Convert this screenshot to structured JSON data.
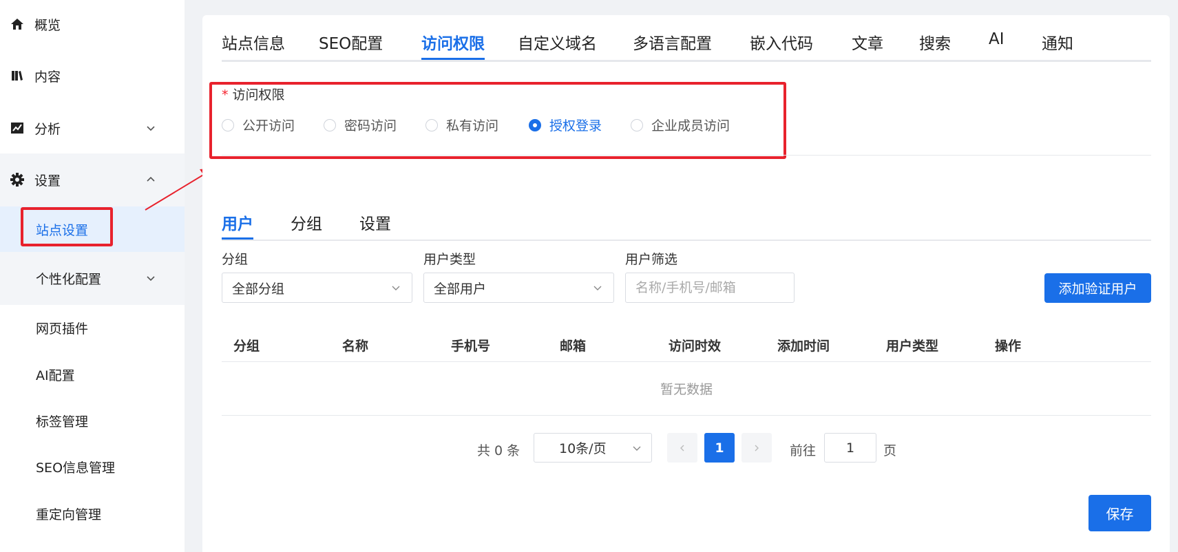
{
  "sidebar": {
    "items": [
      {
        "label": "概览",
        "icon": "home-icon"
      },
      {
        "label": "内容",
        "icon": "book-icon"
      },
      {
        "label": "分析",
        "icon": "chart-icon"
      },
      {
        "label": "设置",
        "icon": "gear-icon"
      }
    ],
    "settings_sub": [
      {
        "label": "站点设置"
      },
      {
        "label": "个性化配置"
      }
    ],
    "other_items": [
      {
        "label": "网页插件"
      },
      {
        "label": "AI配置"
      },
      {
        "label": "标签管理"
      },
      {
        "label": "SEO信息管理"
      },
      {
        "label": "重定向管理"
      }
    ]
  },
  "tabs": [
    {
      "label": "站点信息"
    },
    {
      "label": "SEO配置"
    },
    {
      "label": "访问权限"
    },
    {
      "label": "自定义域名"
    },
    {
      "label": "多语言配置"
    },
    {
      "label": "嵌入代码"
    },
    {
      "label": "文章"
    },
    {
      "label": "搜索"
    },
    {
      "label": "AI"
    },
    {
      "label": "通知"
    }
  ],
  "access": {
    "required_mark": "*",
    "label": "访问权限",
    "options": [
      {
        "label": "公开访问"
      },
      {
        "label": "密码访问"
      },
      {
        "label": "私有访问"
      },
      {
        "label": "授权登录"
      },
      {
        "label": "企业成员访问"
      }
    ],
    "selected": "授权登录"
  },
  "subtabs": [
    {
      "label": "用户"
    },
    {
      "label": "分组"
    },
    {
      "label": "设置"
    }
  ],
  "filters": {
    "group_label": "分组",
    "group_value": "全部分组",
    "type_label": "用户类型",
    "type_value": "全部用户",
    "search_label": "用户筛选",
    "search_placeholder": "名称/手机号/邮箱",
    "add_button": "添加验证用户"
  },
  "table": {
    "columns": [
      "分组",
      "名称",
      "手机号",
      "邮箱",
      "访问时效",
      "添加时间",
      "用户类型",
      "操作"
    ],
    "empty_text": "暂无数据"
  },
  "pagination": {
    "total_text": "共 0 条",
    "page_size": "10条/页",
    "current_page": "1",
    "goto_label": "前往",
    "goto_value": "1",
    "page_suffix": "页"
  },
  "save_button": "保存",
  "colors": {
    "accent": "#1a6fe8",
    "highlight_box": "#e8222d",
    "active_nav_bg": "#e6f0fd"
  }
}
